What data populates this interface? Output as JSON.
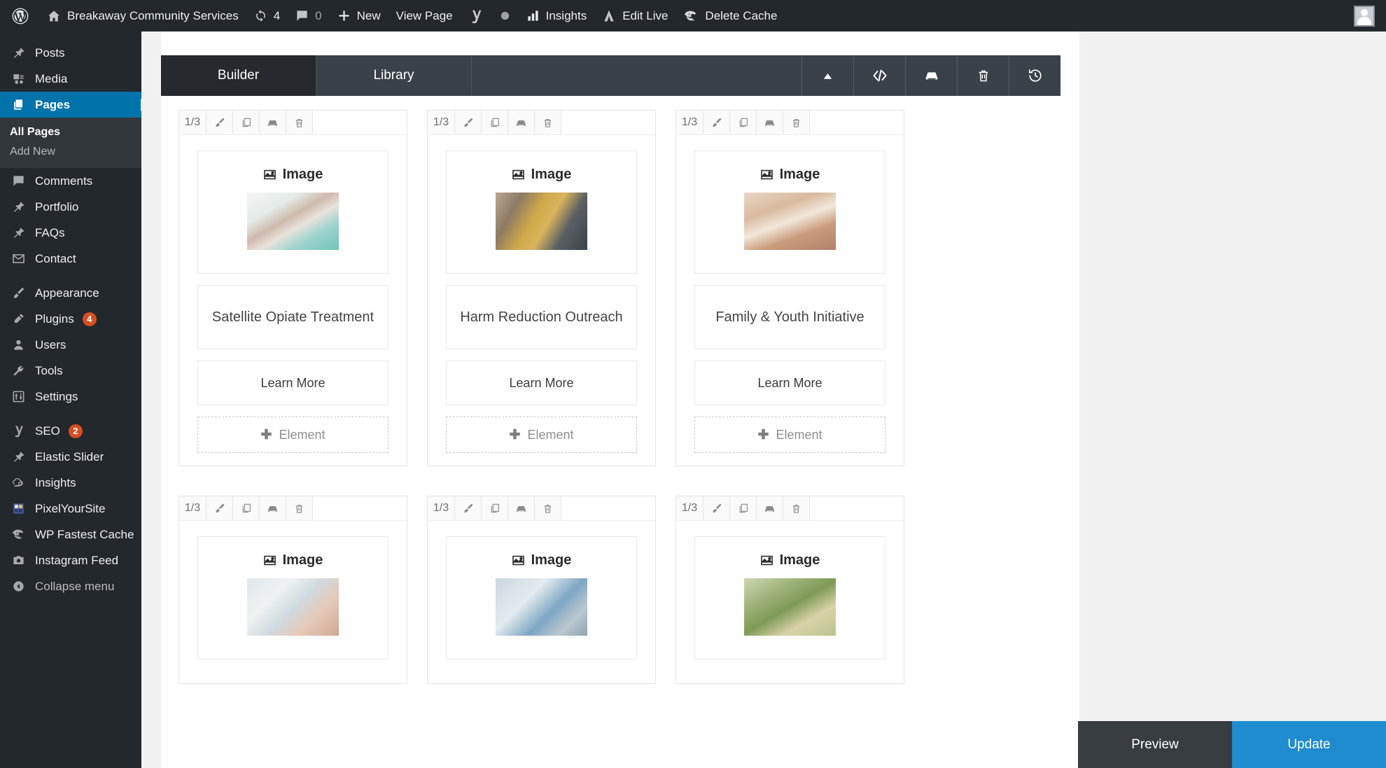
{
  "adminbar": {
    "site_title": "Breakaway Community Services",
    "updates_count": "4",
    "comments_count": "0",
    "new_label": "New",
    "view_page_label": "View Page",
    "insights_label": "Insights",
    "edit_live_label": "Edit Live",
    "delete_cache_label": "Delete Cache",
    "icons": {
      "wordpress": "wordpress-logo-icon",
      "home": "home-icon",
      "updates": "updates-icon",
      "comments": "comment-bubble-icon",
      "new": "plus-icon",
      "yoast": "yoast-seo-icon",
      "dot": "circle-dot-icon",
      "insights": "bar-chart-icon",
      "edit_live": "edit-live-icon",
      "cache": "wp-fastest-cache-icon",
      "avatar": "user-avatar-icon"
    }
  },
  "sidebar": {
    "items": [
      {
        "label": "Posts",
        "icon": "pin-icon",
        "badge": ""
      },
      {
        "label": "Media",
        "icon": "media-icon",
        "badge": ""
      },
      {
        "label": "Pages",
        "icon": "pages-icon",
        "badge": "",
        "current": true
      },
      {
        "label": "Comments",
        "icon": "comment-bubble-icon",
        "badge": ""
      },
      {
        "label": "Portfolio",
        "icon": "pin-icon",
        "badge": ""
      },
      {
        "label": "FAQs",
        "icon": "pin-icon",
        "badge": ""
      },
      {
        "label": "Contact",
        "icon": "envelope-icon",
        "badge": ""
      },
      {
        "label": "Appearance",
        "icon": "paintbrush-icon",
        "badge": ""
      },
      {
        "label": "Plugins",
        "icon": "plug-icon",
        "badge": "4"
      },
      {
        "label": "Users",
        "icon": "user-icon",
        "badge": ""
      },
      {
        "label": "Tools",
        "icon": "wrench-icon",
        "badge": ""
      },
      {
        "label": "Settings",
        "icon": "sliders-icon",
        "badge": ""
      },
      {
        "label": "SEO",
        "icon": "yoast-seo-icon",
        "badge": "2"
      },
      {
        "label": "Elastic Slider",
        "icon": "pin-icon",
        "badge": ""
      },
      {
        "label": "Insights",
        "icon": "monsterinsights-icon",
        "badge": ""
      },
      {
        "label": "PixelYourSite",
        "icon": "pixelyoursite-icon",
        "badge": ""
      },
      {
        "label": "WP Fastest Cache",
        "icon": "wp-fastest-cache-icon",
        "badge": ""
      },
      {
        "label": "Instagram Feed",
        "icon": "camera-icon",
        "badge": ""
      }
    ],
    "submenu": {
      "parent": "Pages",
      "items": [
        {
          "label": "All Pages",
          "active": true
        },
        {
          "label": "Add New",
          "active": false
        }
      ]
    },
    "collapse_label": "Collapse menu",
    "collapse_icon": "collapse-arrow-icon"
  },
  "builder": {
    "tabs": [
      {
        "label": "Builder",
        "active": true
      },
      {
        "label": "Library",
        "active": false
      }
    ],
    "buttons": [
      {
        "name": "collapse-toggle-button",
        "icon": "triangle-up-icon"
      },
      {
        "name": "code-view-button",
        "icon": "code-icon"
      },
      {
        "name": "save-template-button",
        "icon": "save-disk-icon"
      },
      {
        "name": "delete-layout-button",
        "icon": "trash-icon"
      },
      {
        "name": "history-button",
        "icon": "history-clock-icon"
      }
    ]
  },
  "column_toolbar": {
    "width_label": "1/3",
    "buttons": [
      {
        "name": "edit-column-button",
        "icon": "brush-icon"
      },
      {
        "name": "duplicate-column-button",
        "icon": "duplicate-icon"
      },
      {
        "name": "save-column-button",
        "icon": "save-disk-icon"
      },
      {
        "name": "delete-column-button",
        "icon": "trash-icon"
      }
    ]
  },
  "module_labels": {
    "image": "Image",
    "image_icon": "image-placeholder-icon",
    "add_element": "Element",
    "add_icon": "plus-icon"
  },
  "rows": [
    {
      "columns": [
        {
          "width": "1/3",
          "photo": "ph1",
          "heading": "Satellite Opiate Treatment",
          "button": "Learn More"
        },
        {
          "width": "1/3",
          "photo": "ph2",
          "heading": "Harm Reduction Outreach",
          "button": "Learn More"
        },
        {
          "width": "1/3",
          "photo": "ph3",
          "heading": "Family & Youth Initiative",
          "button": "Learn More"
        }
      ]
    },
    {
      "columns": [
        {
          "width": "1/3",
          "photo": "ph4",
          "heading": "",
          "button": ""
        },
        {
          "width": "1/3",
          "photo": "ph5",
          "heading": "",
          "button": ""
        },
        {
          "width": "1/3",
          "photo": "ph6",
          "heading": "",
          "button": ""
        }
      ]
    }
  ],
  "actionbar": {
    "preview_label": "Preview",
    "update_label": "Update"
  },
  "colors": {
    "admin_dark": "#23282d",
    "menu_current": "#0073aa",
    "badge": "#d54e21",
    "builder_bar": "#3a4149",
    "builder_tab_active": "#26292d",
    "update_button": "#1e8cce",
    "preview_button": "#383d42"
  }
}
